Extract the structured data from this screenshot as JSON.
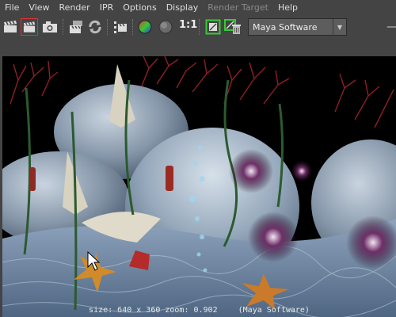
{
  "menubar": {
    "items": [
      "File",
      "View",
      "Render",
      "IPR",
      "Options",
      "Display",
      "Render Target",
      "Help"
    ]
  },
  "toolbar": {
    "icons": [
      "clapper-icon",
      "clapper-region-icon",
      "camera-snapshot-icon",
      "clapper-sequence-icon",
      "refresh-icon",
      "clapper-list-icon",
      "rgb-channels-icon",
      "alpha-channel-icon",
      "frame-icon",
      "clear-icon"
    ],
    "ratio_label": "1:1",
    "renderer_value": "Maya Software"
  },
  "status": {
    "size_text": "size: 640 x 360 zoom: 0.902",
    "renderer_text": "(Maya Software)"
  }
}
